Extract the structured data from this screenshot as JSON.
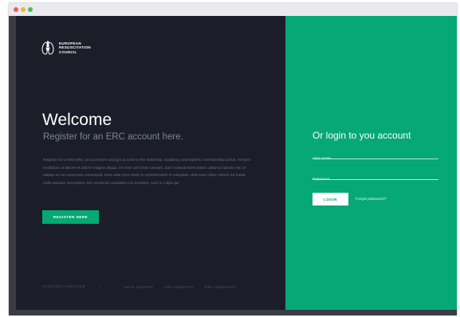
{
  "window": {
    "controls": [
      "close",
      "minimize",
      "maximize"
    ]
  },
  "brand": {
    "line1": "EUROPEAN",
    "line2": "RESUSCITATION",
    "line3": "COUNCIL",
    "icon": "heart-lungs-logo"
  },
  "left": {
    "title": "Welcome",
    "subtitle": "Register for an ERC account here.",
    "description": "Register for a free ERC account here and get access to the webshop, academy and MyERC membership portal. Tempor incididunt ut labore et dolore magna aliqua. Ut enim ad minim veniam, quis nostrud exercitation ullamco laboris nisi ut aliquip ex ea commodo consequat. Duis aute irure dolor in reprehenderit in voluptate velit esse cillum dolore eu fugiat nulla pariatur. Excepteur sint occaecat cupidatat non proident, sunt in culpa qui",
    "register_button": "REGISTER HERE"
  },
  "footer": {
    "language": "CHOOSE LANGUAGE",
    "language_chevron": "⌄",
    "help": "HELP CENTER",
    "website": "ERC WEBSITE",
    "webshop": "ERC WEBSHOP"
  },
  "login": {
    "title": "Or login to you account",
    "email_placeholder": "Your email",
    "password_placeholder": "Password",
    "login_button": "LOGIN",
    "forgot": "Forgot password?"
  },
  "colors": {
    "dark_panel": "#1b1e28",
    "accent_green": "#06a874",
    "frame": "#3a3d45"
  }
}
